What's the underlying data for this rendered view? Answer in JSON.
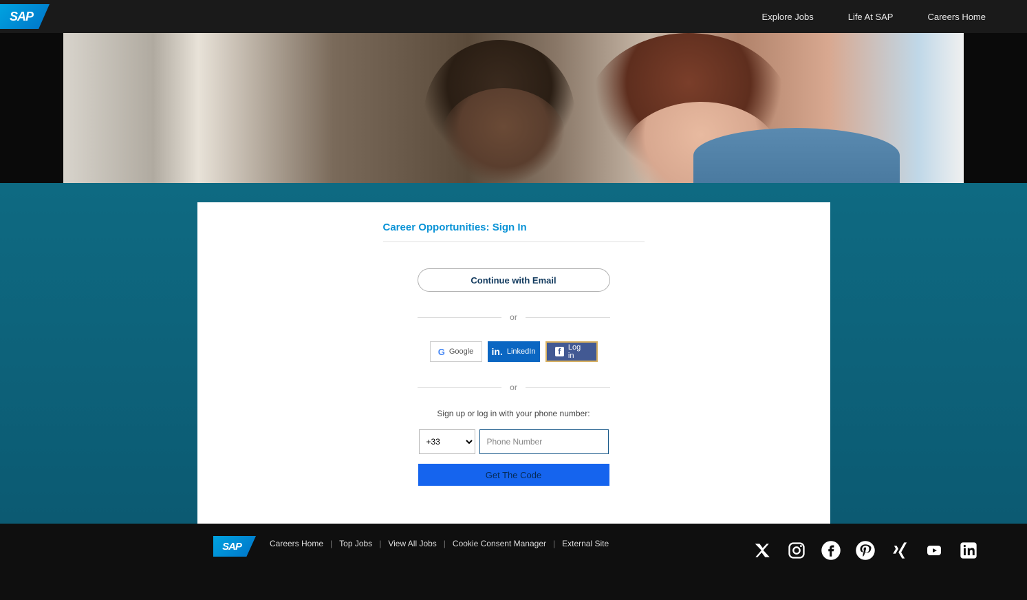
{
  "brand": "SAP",
  "header": {
    "nav": [
      {
        "label": "Explore Jobs"
      },
      {
        "label": "Life At SAP"
      },
      {
        "label": "Careers Home"
      }
    ]
  },
  "signin": {
    "title": "Career Opportunities: Sign In",
    "continue_email": "Continue with Email",
    "or": "or",
    "google_label": "Google",
    "linkedin_label": "LinkedIn",
    "facebook_label": "Log in",
    "phone_prompt": "Sign up or log in with your phone number:",
    "country_code": "+33",
    "phone_placeholder": "Phone Number",
    "get_code": "Get The Code"
  },
  "footer": {
    "links": [
      {
        "label": "Careers Home"
      },
      {
        "label": "Top Jobs"
      },
      {
        "label": "View All Jobs"
      },
      {
        "label": "Cookie Consent Manager"
      },
      {
        "label": "External Site"
      }
    ],
    "social": [
      "x",
      "instagram",
      "facebook",
      "pinterest",
      "xing",
      "youtube",
      "linkedin"
    ]
  }
}
